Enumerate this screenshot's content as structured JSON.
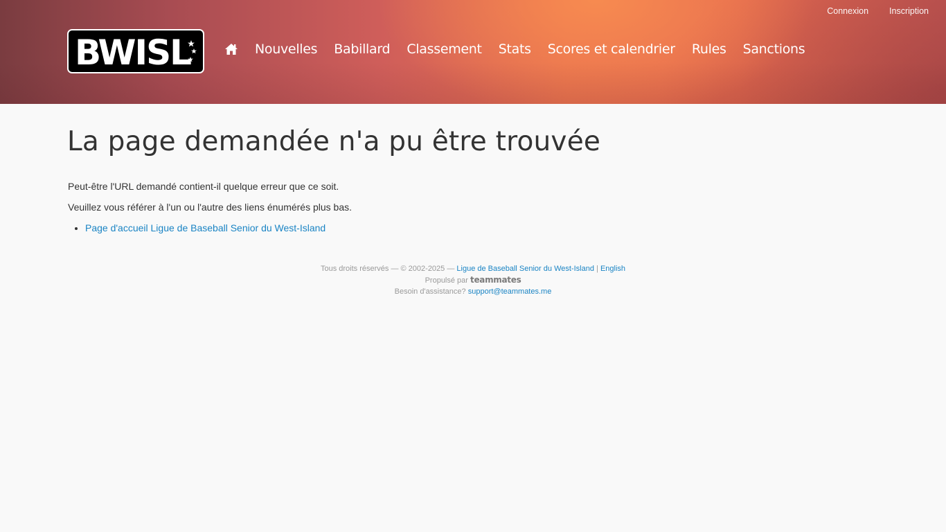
{
  "header": {
    "logo_text": "BWISL",
    "top_links": [
      "Connexion",
      "Inscription"
    ],
    "nav": {
      "home_icon": "home-icon",
      "items": [
        "Nouvelles",
        "Babillard",
        "Classement",
        "Stats",
        "Scores et calendrier",
        "Rules",
        "Sanctions"
      ]
    }
  },
  "main": {
    "title": "La page demandée n'a pu être trouvée",
    "paragraph1": "Peut-être l'URL demandé contient-il quelque erreur que ce soit.",
    "paragraph2": "Veuillez vous référer à l'un ou l'autre des liens énumérés plus bas.",
    "links": [
      "Page d'accueil Ligue de Baseball Senior du West-Island"
    ]
  },
  "footer": {
    "rights": "Tous droits réservés — © 2002-2025 —",
    "league_link": "Ligue de Baseball Senior du West-Island",
    "separator": "|",
    "english_link": "English",
    "powered_by": "Propulsé par",
    "powered_logo": "teammates",
    "help": "Besoin d'assistance?",
    "support_email": "support@teammates.me"
  },
  "colors": {
    "link": "#1a84c4",
    "header_accent": "#e8704f",
    "background": "#f9f9f9"
  }
}
